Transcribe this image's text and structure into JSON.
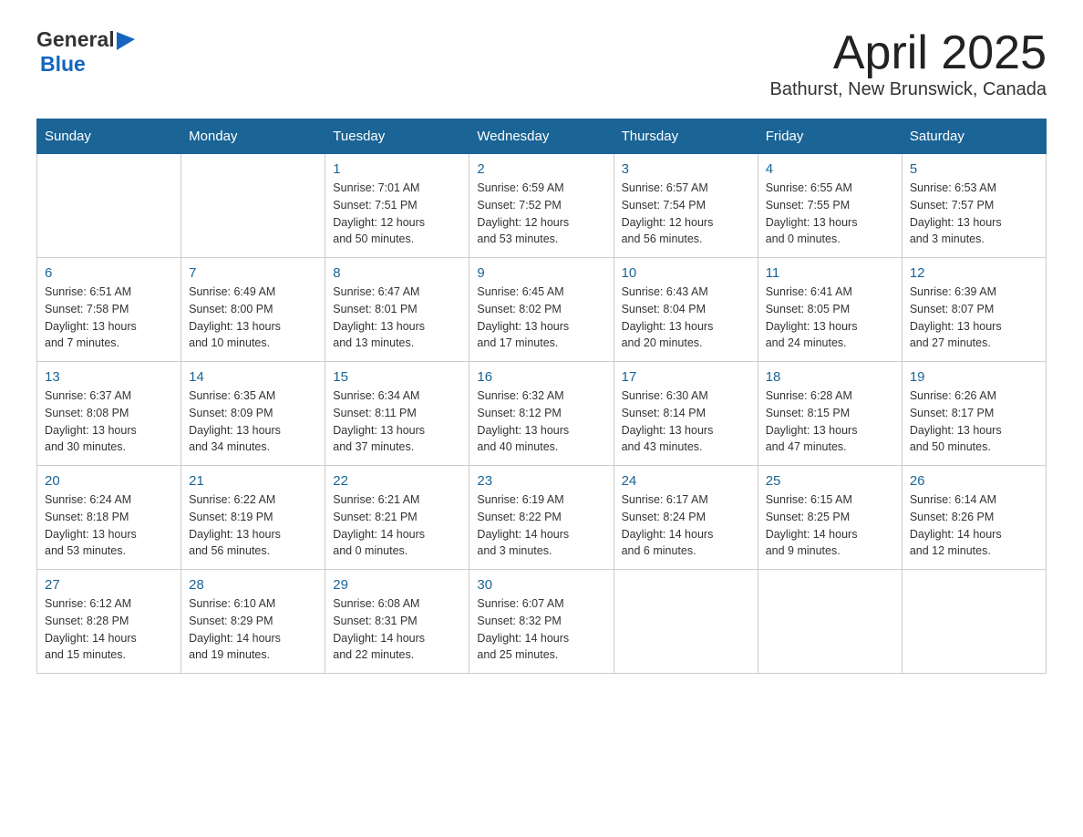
{
  "header": {
    "logo_general": "General",
    "logo_blue": "Blue",
    "title": "April 2025",
    "subtitle": "Bathurst, New Brunswick, Canada"
  },
  "calendar": {
    "days_of_week": [
      "Sunday",
      "Monday",
      "Tuesday",
      "Wednesday",
      "Thursday",
      "Friday",
      "Saturday"
    ],
    "weeks": [
      [
        {
          "day": "",
          "info": ""
        },
        {
          "day": "",
          "info": ""
        },
        {
          "day": "1",
          "info": "Sunrise: 7:01 AM\nSunset: 7:51 PM\nDaylight: 12 hours\nand 50 minutes."
        },
        {
          "day": "2",
          "info": "Sunrise: 6:59 AM\nSunset: 7:52 PM\nDaylight: 12 hours\nand 53 minutes."
        },
        {
          "day": "3",
          "info": "Sunrise: 6:57 AM\nSunset: 7:54 PM\nDaylight: 12 hours\nand 56 minutes."
        },
        {
          "day": "4",
          "info": "Sunrise: 6:55 AM\nSunset: 7:55 PM\nDaylight: 13 hours\nand 0 minutes."
        },
        {
          "day": "5",
          "info": "Sunrise: 6:53 AM\nSunset: 7:57 PM\nDaylight: 13 hours\nand 3 minutes."
        }
      ],
      [
        {
          "day": "6",
          "info": "Sunrise: 6:51 AM\nSunset: 7:58 PM\nDaylight: 13 hours\nand 7 minutes."
        },
        {
          "day": "7",
          "info": "Sunrise: 6:49 AM\nSunset: 8:00 PM\nDaylight: 13 hours\nand 10 minutes."
        },
        {
          "day": "8",
          "info": "Sunrise: 6:47 AM\nSunset: 8:01 PM\nDaylight: 13 hours\nand 13 minutes."
        },
        {
          "day": "9",
          "info": "Sunrise: 6:45 AM\nSunset: 8:02 PM\nDaylight: 13 hours\nand 17 minutes."
        },
        {
          "day": "10",
          "info": "Sunrise: 6:43 AM\nSunset: 8:04 PM\nDaylight: 13 hours\nand 20 minutes."
        },
        {
          "day": "11",
          "info": "Sunrise: 6:41 AM\nSunset: 8:05 PM\nDaylight: 13 hours\nand 24 minutes."
        },
        {
          "day": "12",
          "info": "Sunrise: 6:39 AM\nSunset: 8:07 PM\nDaylight: 13 hours\nand 27 minutes."
        }
      ],
      [
        {
          "day": "13",
          "info": "Sunrise: 6:37 AM\nSunset: 8:08 PM\nDaylight: 13 hours\nand 30 minutes."
        },
        {
          "day": "14",
          "info": "Sunrise: 6:35 AM\nSunset: 8:09 PM\nDaylight: 13 hours\nand 34 minutes."
        },
        {
          "day": "15",
          "info": "Sunrise: 6:34 AM\nSunset: 8:11 PM\nDaylight: 13 hours\nand 37 minutes."
        },
        {
          "day": "16",
          "info": "Sunrise: 6:32 AM\nSunset: 8:12 PM\nDaylight: 13 hours\nand 40 minutes."
        },
        {
          "day": "17",
          "info": "Sunrise: 6:30 AM\nSunset: 8:14 PM\nDaylight: 13 hours\nand 43 minutes."
        },
        {
          "day": "18",
          "info": "Sunrise: 6:28 AM\nSunset: 8:15 PM\nDaylight: 13 hours\nand 47 minutes."
        },
        {
          "day": "19",
          "info": "Sunrise: 6:26 AM\nSunset: 8:17 PM\nDaylight: 13 hours\nand 50 minutes."
        }
      ],
      [
        {
          "day": "20",
          "info": "Sunrise: 6:24 AM\nSunset: 8:18 PM\nDaylight: 13 hours\nand 53 minutes."
        },
        {
          "day": "21",
          "info": "Sunrise: 6:22 AM\nSunset: 8:19 PM\nDaylight: 13 hours\nand 56 minutes."
        },
        {
          "day": "22",
          "info": "Sunrise: 6:21 AM\nSunset: 8:21 PM\nDaylight: 14 hours\nand 0 minutes."
        },
        {
          "day": "23",
          "info": "Sunrise: 6:19 AM\nSunset: 8:22 PM\nDaylight: 14 hours\nand 3 minutes."
        },
        {
          "day": "24",
          "info": "Sunrise: 6:17 AM\nSunset: 8:24 PM\nDaylight: 14 hours\nand 6 minutes."
        },
        {
          "day": "25",
          "info": "Sunrise: 6:15 AM\nSunset: 8:25 PM\nDaylight: 14 hours\nand 9 minutes."
        },
        {
          "day": "26",
          "info": "Sunrise: 6:14 AM\nSunset: 8:26 PM\nDaylight: 14 hours\nand 12 minutes."
        }
      ],
      [
        {
          "day": "27",
          "info": "Sunrise: 6:12 AM\nSunset: 8:28 PM\nDaylight: 14 hours\nand 15 minutes."
        },
        {
          "day": "28",
          "info": "Sunrise: 6:10 AM\nSunset: 8:29 PM\nDaylight: 14 hours\nand 19 minutes."
        },
        {
          "day": "29",
          "info": "Sunrise: 6:08 AM\nSunset: 8:31 PM\nDaylight: 14 hours\nand 22 minutes."
        },
        {
          "day": "30",
          "info": "Sunrise: 6:07 AM\nSunset: 8:32 PM\nDaylight: 14 hours\nand 25 minutes."
        },
        {
          "day": "",
          "info": ""
        },
        {
          "day": "",
          "info": ""
        },
        {
          "day": "",
          "info": ""
        }
      ]
    ]
  }
}
